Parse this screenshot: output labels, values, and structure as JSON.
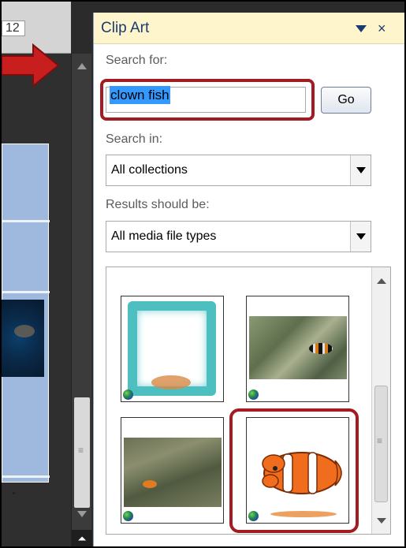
{
  "document": {
    "ruler_label": "12"
  },
  "pane": {
    "title": "Clip Art",
    "search_label": "Search for:",
    "search_value": "clown fish",
    "go_label": "Go",
    "search_in_label": "Search in:",
    "search_in_value": "All collections",
    "results_label": "Results should be:",
    "results_value": "All media file types"
  },
  "results": {
    "items": [
      {
        "name": "clip-frame-aquarium"
      },
      {
        "name": "clip-photo-clownfish-anemone"
      },
      {
        "name": "clip-photo-clownfish-reef"
      },
      {
        "name": "clip-clownfish-drawing"
      }
    ]
  },
  "colors": {
    "highlight": "#a21c22",
    "pane_header": "#fff5cc",
    "title_text": "#1a3b70",
    "selection": "#3399ff"
  }
}
